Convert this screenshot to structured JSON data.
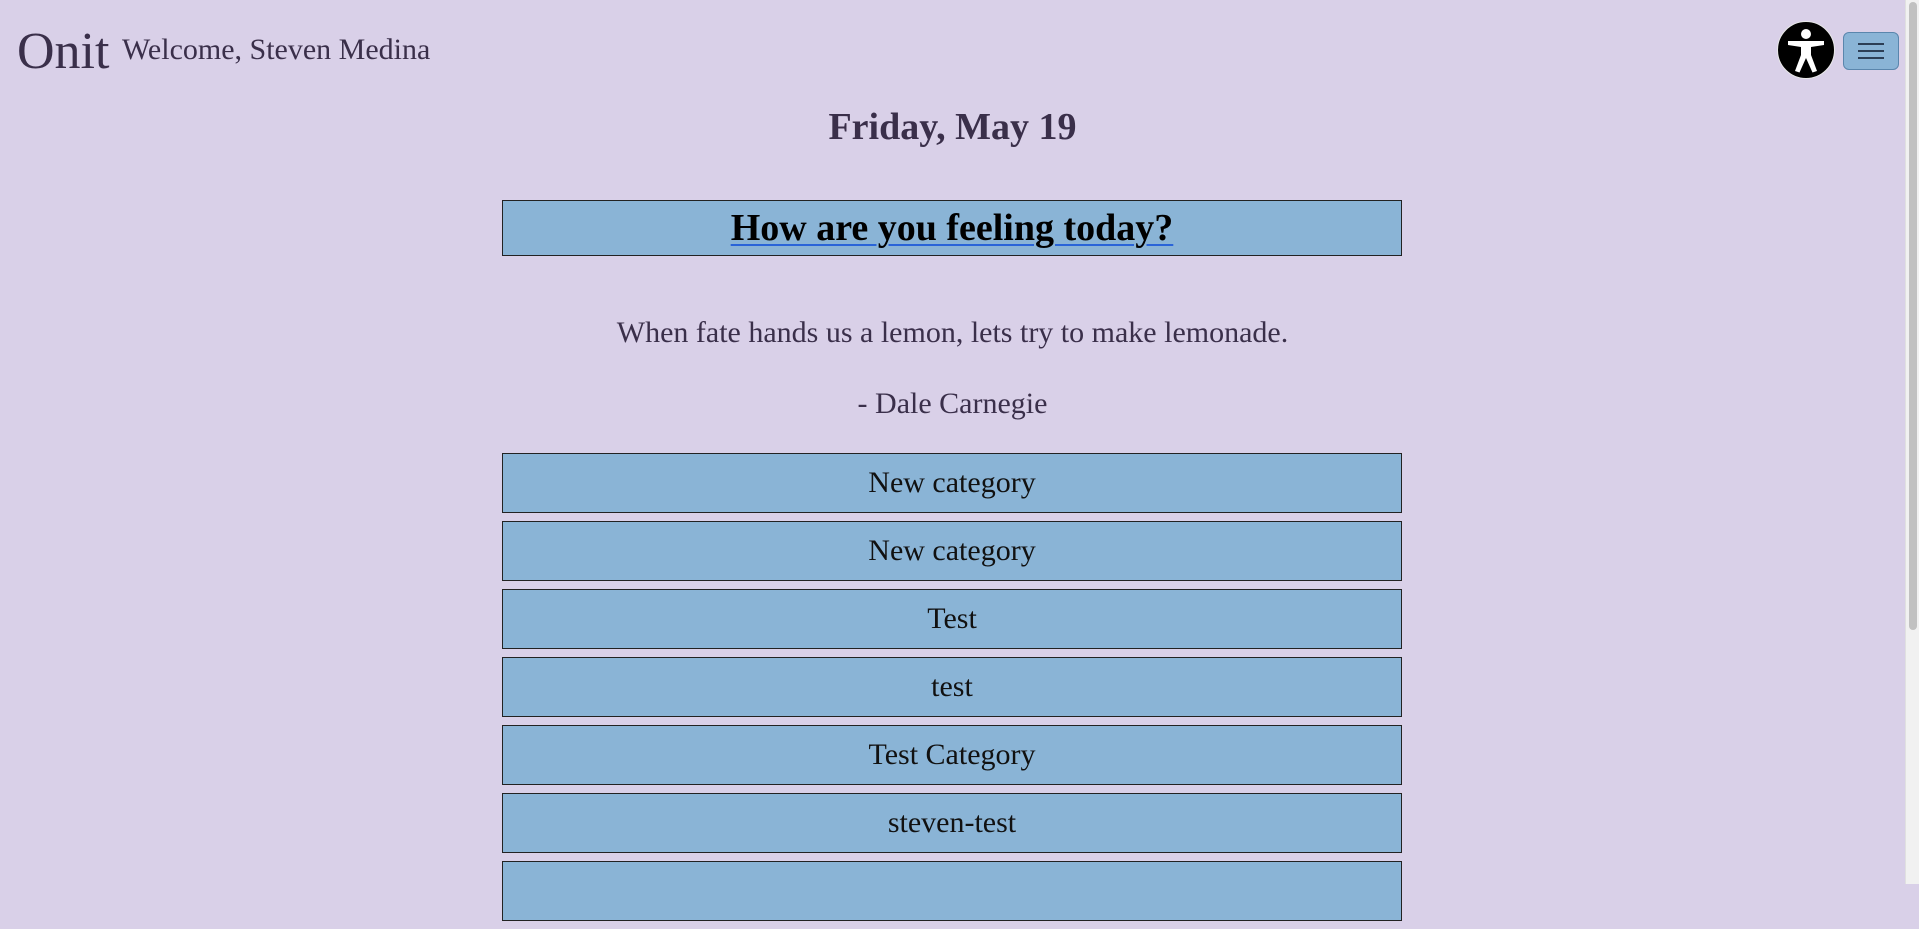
{
  "header": {
    "brand": "Onit",
    "welcome": "Welcome, Steven Medina",
    "accessibility_icon": "accessibility-person-icon",
    "menu_icon": "hamburger-menu-icon"
  },
  "date": "Friday, May 19",
  "mood_prompt": "How are you feeling today?",
  "quote": {
    "text": "When fate hands us a lemon, lets try to make lemonade.",
    "author": "- Dale Carnegie"
  },
  "categories": [
    {
      "label": "New category"
    },
    {
      "label": "New category"
    },
    {
      "label": "Test"
    },
    {
      "label": "test"
    },
    {
      "label": "Test Category"
    },
    {
      "label": "steven-test"
    },
    {
      "label": ""
    }
  ],
  "colors": {
    "background": "#d9d0e8",
    "button_blue": "#8ab4d6",
    "text_dark": "#3a2f4a",
    "link_underline": "#2a64d8"
  }
}
